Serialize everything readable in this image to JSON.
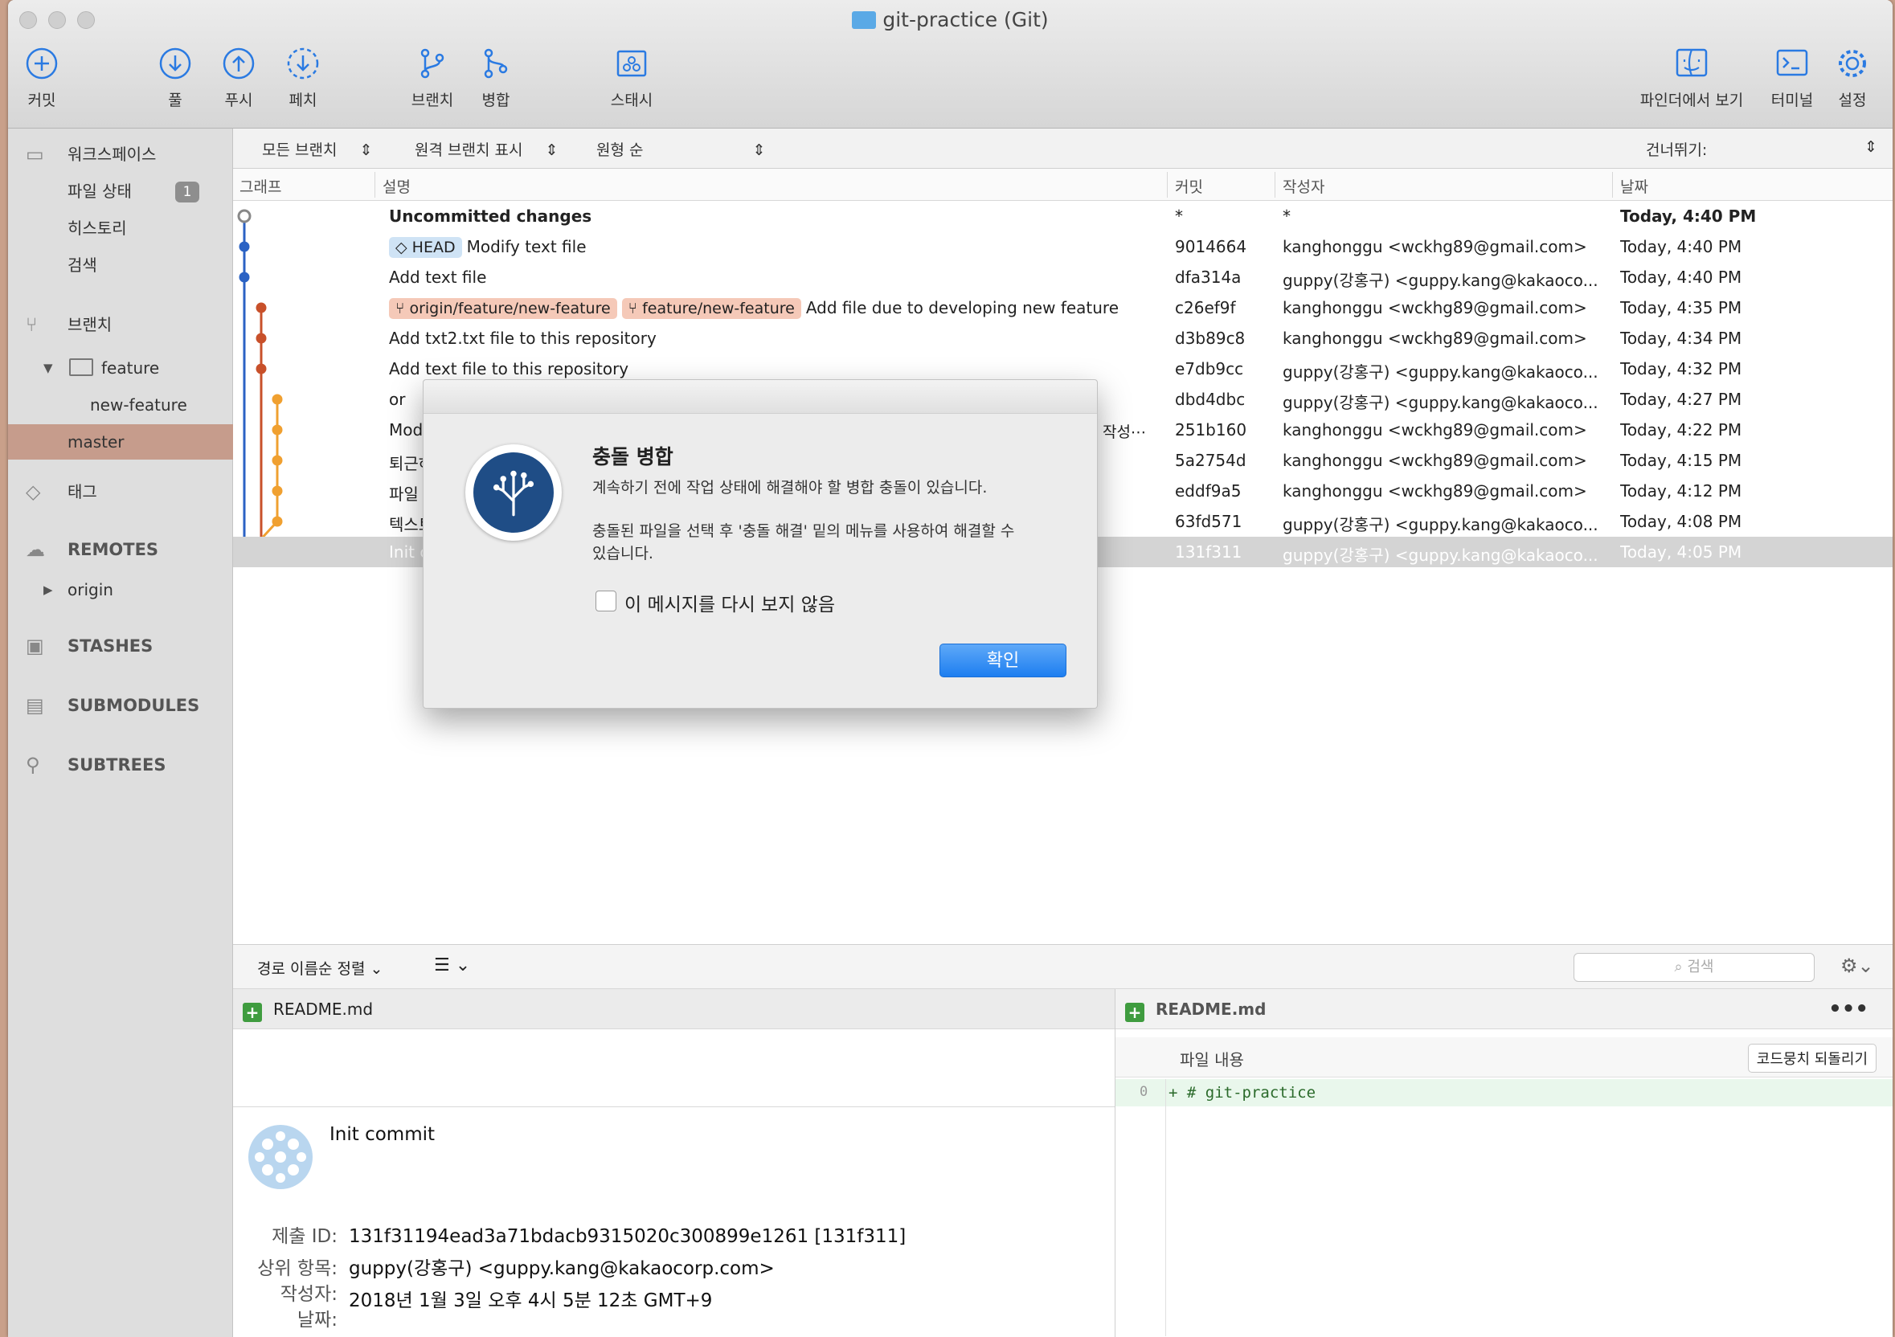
{
  "window": {
    "title": "git-practice (Git)"
  },
  "toolbar": {
    "commit": "커밋",
    "pull": "풀",
    "push": "푸시",
    "fetch": "페치",
    "branch": "브랜치",
    "merge": "병합",
    "stash": "스태시",
    "finder": "파인더에서 보기",
    "terminal": "터미널",
    "settings": "설정"
  },
  "sidebar": {
    "workspace": "워크스페이스",
    "file_status": "파일 상태",
    "file_status_count": "1",
    "history": "히스토리",
    "search": "검색",
    "branches": "브랜치",
    "feature_folder": "feature",
    "new_feature": "new-feature",
    "master": "master",
    "tags": "태그",
    "remotes": "REMOTES",
    "origin": "origin",
    "stashes": "STASHES",
    "submodules": "SUBMODULES",
    "subtrees": "SUBTREES"
  },
  "filters": {
    "all_branches": "모든 브랜치",
    "show_remote": "원격 브랜치 표시",
    "order": "원형 순",
    "jump": "건너뛰기:"
  },
  "columns": {
    "graph": "그래프",
    "description": "설명",
    "commit": "커밋",
    "author": "작성자",
    "date": "날짜"
  },
  "commits": [
    {
      "tags": [],
      "desc": "Uncommitted changes",
      "hash": "*",
      "author": "*",
      "date": "Today, 4:40 PM",
      "bold": true
    },
    {
      "tags": [
        "HEAD"
      ],
      "desc": "Modify text file",
      "hash": "9014664",
      "author": "kanghonggu <wckhg89@gmail.com>",
      "date": "Today, 4:40 PM"
    },
    {
      "tags": [],
      "desc": "Add text file",
      "hash": "dfa314a",
      "author": "guppy(강홍구) <guppy.kang@kakaoco...",
      "date": "Today, 4:40 PM"
    },
    {
      "tags": [
        "origin/feature/new-feature",
        "feature/new-feature"
      ],
      "desc": "Add file due to developing new feature",
      "hash": "c26ef9f",
      "author": "kanghonggu <wckhg89@gmail.com>",
      "date": "Today, 4:35 PM"
    },
    {
      "tags": [],
      "desc": "Add txt2.txt file to this repository",
      "hash": "d3b89c8",
      "author": "kanghonggu <wckhg89@gmail.com>",
      "date": "Today, 4:34 PM"
    },
    {
      "tags": [],
      "desc": "Add text file to this repository",
      "hash": "e7db9cc",
      "author": "guppy(강홍구) <guppy.kang@kakaoco...",
      "date": "Today, 4:32 PM"
    },
    {
      "tags": [],
      "desc": "or",
      "hash": "dbd4dbc",
      "author": "guppy(강홍구) <guppy.kang@kakaoco...",
      "date": "Today, 4:27 PM"
    },
    {
      "tags": [],
      "desc": "Modi",
      "hash": "251b160",
      "author": "kanghonggu <wckhg89@gmail.com>",
      "date": "Today, 4:22 PM"
    },
    {
      "tags": [],
      "desc": "퇴근하",
      "hash": "5a2754d",
      "author": "kanghonggu <wckhg89@gmail.com>",
      "date": "Today, 4:15 PM"
    },
    {
      "tags": [],
      "desc": "파일 L",
      "hash": "eddf9a5",
      "author": "kanghonggu <wckhg89@gmail.com>",
      "date": "Today, 4:12 PM"
    },
    {
      "tags": [],
      "desc": "텍스트",
      "hash": "63fd571",
      "author": "guppy(강홍구) <guppy.kang@kakaoco...",
      "date": "Today, 4:08 PM"
    },
    {
      "tags": [],
      "desc": "Init c",
      "hash": "131f311",
      "author": "guppy(강홍구) <guppy.kang@kakaoco...",
      "date": "Today, 4:05 PM",
      "selected": true
    }
  ],
  "partial_desc_suffix": "작성⋯",
  "lower": {
    "sort": "경로 이름순 정렬",
    "search_placeholder": "검색",
    "file_left": "README.md",
    "file_right": "README.md",
    "content_label": "파일 내용",
    "revert_button": "코드뭉치 되돌리기",
    "diff_line_no": "0",
    "diff_line": "+ # git-practice",
    "commit_message": "Init commit",
    "commit_id_label": "제출 ID:",
    "commit_id": "131f31194ead3a71bdacb9315020c300899e1261 [131f311]",
    "parent_label": "상위 항목:",
    "parent": "guppy(강홍구) <guppy.kang@kakaocorp.com>",
    "author_label": "작성자:",
    "author_date": "2018년 1월 3일 오후 4시 5분 12초 GMT+9",
    "date_label": "날짜:"
  },
  "modal": {
    "title": "충돌 병합",
    "line1": "계속하기 전에 작업 상태에 해결해야 할 병합 충돌이 있습니다.",
    "line2": "충돌된 파일을 선택 후 '충돌 해결' 밑의 메뉴를 사용하여 해결할 수",
    "line3": "있습니다.",
    "checkbox": "이 메시지를 다시 보지 않음",
    "ok": "확인"
  },
  "colors": {
    "accent": "#1d7ef0",
    "graph_blue": "#2b62c4",
    "graph_red": "#c8502a",
    "graph_orange": "#f0a030",
    "selection": "#c69c8c"
  }
}
